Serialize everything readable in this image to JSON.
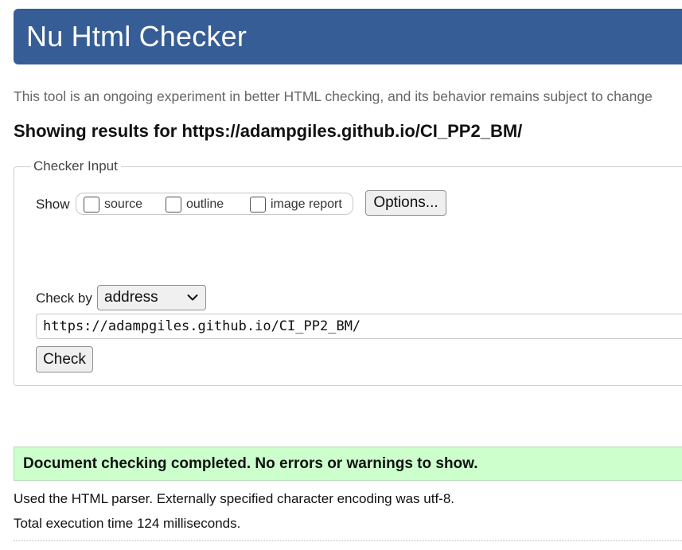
{
  "header": {
    "title": "Nu Html Checker"
  },
  "tagline": "This tool is an ongoing experiment in better HTML checking, and its behavior remains subject to change",
  "results_heading": "Showing results for https://adampgiles.github.io/CI_PP2_BM/",
  "checker_input": {
    "legend": "Checker Input",
    "show_label": "Show",
    "checkboxes": [
      {
        "label": "source",
        "checked": false
      },
      {
        "label": "outline",
        "checked": false
      },
      {
        "label": "image report",
        "checked": false
      }
    ],
    "options_button": "Options...",
    "check_by_label": "Check by",
    "check_by_selected": "address",
    "url_value": "https://adampgiles.github.io/CI_PP2_BM/",
    "check_button": "Check"
  },
  "result": {
    "success_message": "Document checking completed. No errors or warnings to show.",
    "parser_info": "Used the HTML parser. Externally specified character encoding was utf-8.",
    "execution_time": "Total execution time 124 milliseconds."
  },
  "colors": {
    "banner": "#365d95",
    "success_bg": "#ccffcc"
  },
  "icons": {
    "select_arrow": "chevron-down-icon"
  }
}
